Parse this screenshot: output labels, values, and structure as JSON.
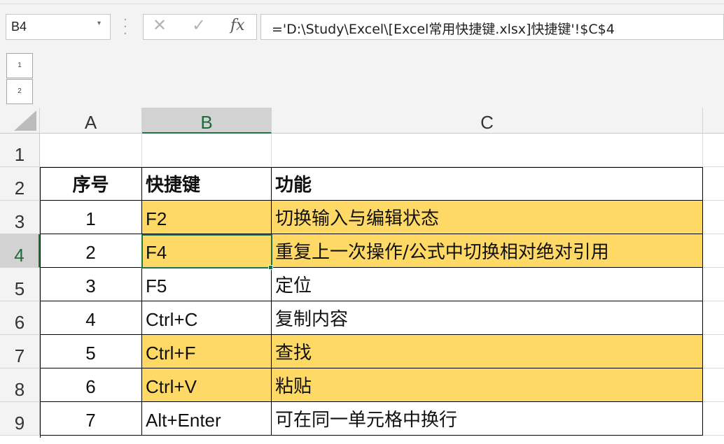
{
  "formula_bar": {
    "name_box": "B4",
    "formula": "='D:\\Study\\Excel\\[Excel常用快捷键.xlsx]快捷键'!$C$4",
    "fx_label": "fx"
  },
  "outline_levels": [
    "1",
    "2"
  ],
  "columns": [
    "A",
    "B",
    "C"
  ],
  "rows": [
    {
      "num": "1",
      "a": "",
      "b": "",
      "c": ""
    },
    {
      "num": "2",
      "a": "序号",
      "b": "快捷键",
      "c": "功能"
    },
    {
      "num": "3",
      "a": "1",
      "b": "F2",
      "c": "切换输入与编辑状态"
    },
    {
      "num": "4",
      "a": "2",
      "b": "F4",
      "c": "重复上一次操作/公式中切换相对绝对引用"
    },
    {
      "num": "5",
      "a": "3",
      "b": "F5",
      "c": "定位"
    },
    {
      "num": "6",
      "a": "4",
      "b": "Ctrl+C",
      "c": "复制内容"
    },
    {
      "num": "7",
      "a": "5",
      "b": "Ctrl+F",
      "c": "查找"
    },
    {
      "num": "8",
      "a": "6",
      "b": "Ctrl+V",
      "c": "粘贴"
    },
    {
      "num": "9",
      "a": "7",
      "b": "Alt+Enter",
      "c": "可在同一单元格中换行"
    }
  ],
  "colors": {
    "highlight": "#ffd966",
    "selection": "#217346"
  }
}
